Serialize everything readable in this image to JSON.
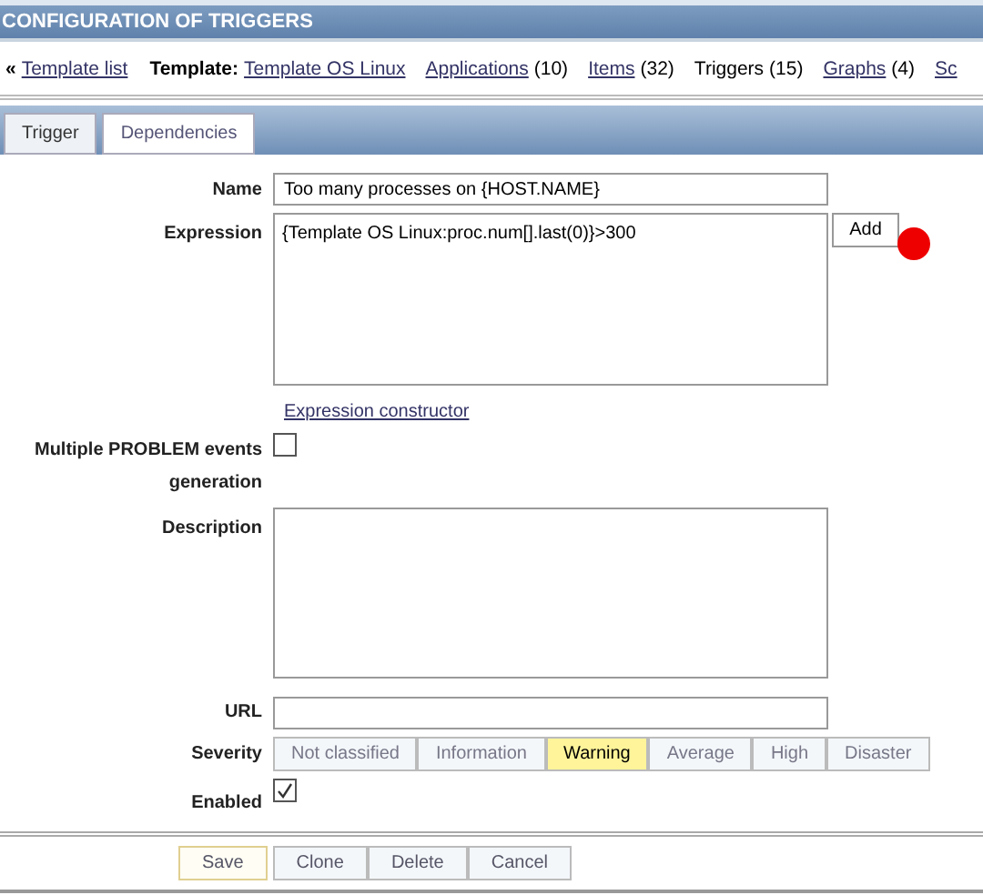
{
  "header": {
    "title": "CONFIGURATION OF TRIGGERS"
  },
  "nav": {
    "back_marker": "«",
    "back_link": "Template list",
    "template_label": "Template:",
    "template_link": "Template OS Linux",
    "items": [
      {
        "label": "Applications",
        "count": "(10)",
        "kind": "link"
      },
      {
        "label": "Items",
        "count": "(32)",
        "kind": "link"
      },
      {
        "label": "Triggers",
        "count": "(15)",
        "kind": "current"
      },
      {
        "label": "Graphs",
        "count": "(4)",
        "kind": "link"
      },
      {
        "label": "Sc",
        "kind": "link"
      }
    ]
  },
  "tabs": [
    {
      "label": "Trigger",
      "selected": true
    },
    {
      "label": "Dependencies",
      "selected": false
    }
  ],
  "form": {
    "name_label": "Name",
    "name_value": "Too many processes on {HOST.NAME}",
    "expression_label": "Expression",
    "expression_value": "{Template OS Linux:proc.num[].last(0)}>300",
    "add_button": "Add",
    "constructor_link": "Expression constructor",
    "multiple_label": "Multiple PROBLEM events generation",
    "multiple_checked": false,
    "description_label": "Description",
    "url_label": "URL",
    "severity_label": "Severity",
    "severities": [
      {
        "label": "Not classified",
        "selected": false
      },
      {
        "label": "Information",
        "selected": false
      },
      {
        "label": "Warning",
        "selected": true
      },
      {
        "label": "Average",
        "selected": false
      },
      {
        "label": "High",
        "selected": false
      },
      {
        "label": "Disaster",
        "selected": false
      }
    ],
    "enabled_label": "Enabled",
    "enabled_checked": true
  },
  "footer": {
    "buttons": [
      {
        "label": "Save",
        "kind": "primary"
      },
      {
        "label": "Clone",
        "kind": "normal"
      },
      {
        "label": "Delete",
        "kind": "normal"
      },
      {
        "label": "Cancel",
        "kind": "normal"
      }
    ]
  }
}
